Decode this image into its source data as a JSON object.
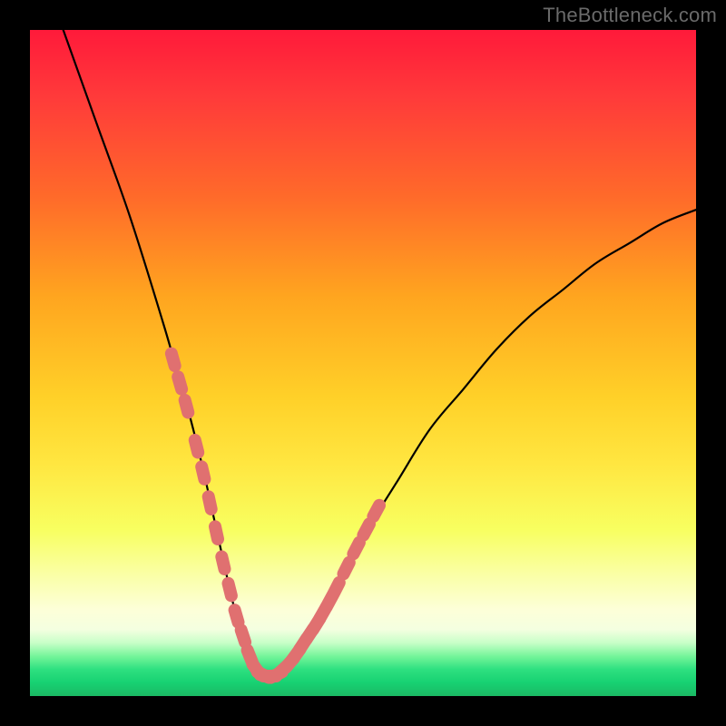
{
  "watermark": "TheBottleneck.com",
  "colors": {
    "frame": "#000000",
    "gradient_top": "#ff1a3a",
    "gradient_bottom": "#1bb964",
    "curve": "#000000",
    "marker": "#e07070",
    "watermark": "#6a6a6a"
  },
  "chart_data": {
    "type": "line",
    "title": "",
    "xlabel": "",
    "ylabel": "",
    "xlim": [
      0,
      100
    ],
    "ylim": [
      0,
      100
    ],
    "series": [
      {
        "name": "bottleneck-curve",
        "x": [
          5,
          10,
          15,
          20,
          22,
          24,
          26,
          28,
          30,
          31,
          32,
          33,
          34,
          35,
          36,
          37,
          38,
          40,
          42,
          44,
          46,
          48,
          50,
          55,
          60,
          65,
          70,
          75,
          80,
          85,
          90,
          95,
          100
        ],
        "values": [
          100,
          86,
          72,
          56,
          49,
          42,
          34,
          25,
          16,
          12,
          9,
          6,
          4,
          3,
          3,
          3,
          4,
          6,
          9,
          12,
          16,
          20,
          24,
          32,
          40,
          46,
          52,
          57,
          61,
          65,
          68,
          71,
          73
        ]
      }
    ],
    "markers": {
      "name": "highlight-points",
      "x": [
        21.5,
        22.5,
        23.5,
        25.0,
        26.0,
        27.0,
        28.0,
        29.0,
        30.0,
        31.0,
        32.0,
        33.0,
        34.0,
        35.0,
        36.0,
        37.0,
        38.0,
        39.0,
        40.0,
        41.0,
        42.0,
        43.0,
        44.0,
        45.0,
        46.0,
        47.5,
        49.0,
        50.5,
        52.0
      ],
      "values": [
        50.5,
        47.0,
        43.5,
        37.5,
        33.5,
        29.0,
        24.5,
        20.0,
        16.0,
        12.0,
        9.0,
        6.0,
        4.0,
        3.2,
        3.0,
        3.2,
        4.0,
        5.0,
        6.3,
        7.8,
        9.3,
        10.8,
        12.5,
        14.3,
        16.2,
        19.2,
        22.2,
        25.0,
        27.8
      ]
    }
  }
}
